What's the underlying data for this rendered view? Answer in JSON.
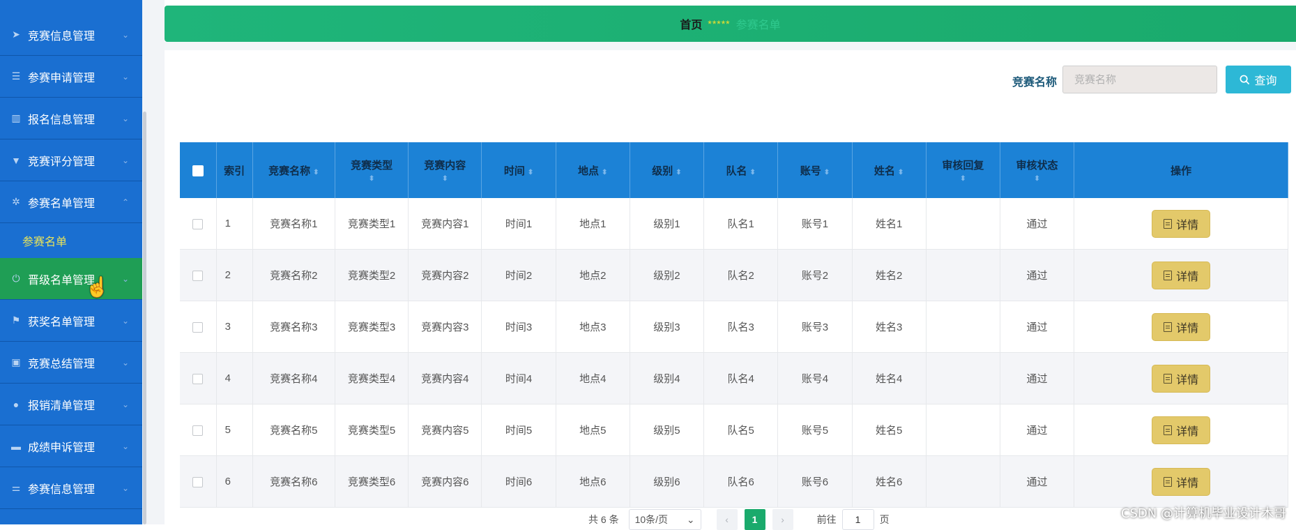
{
  "sidebar": {
    "items": [
      {
        "label": "竞赛信息管理",
        "icon": "send-icon",
        "glyph": "➤",
        "chevron": "⌄"
      },
      {
        "label": "参赛申请管理",
        "icon": "list-icon",
        "glyph": "☰",
        "chevron": "⌄"
      },
      {
        "label": "报名信息管理",
        "icon": "chart-icon",
        "glyph": "▥",
        "chevron": "⌄"
      },
      {
        "label": "竞赛评分管理",
        "icon": "comment-icon",
        "glyph": "▼",
        "chevron": "⌄"
      },
      {
        "label": "参赛名单管理",
        "icon": "settings-icon",
        "glyph": "✲",
        "chevron": "⌃"
      },
      {
        "label": "晋级名单管理",
        "icon": "power-icon",
        "glyph": "⏻",
        "chevron": "⌄"
      },
      {
        "label": "获奖名单管理",
        "icon": "flag-icon",
        "glyph": "⚑",
        "chevron": "⌄"
      },
      {
        "label": "竞赛总结管理",
        "icon": "clipboard-icon",
        "glyph": "▣",
        "chevron": "⌄"
      },
      {
        "label": "报销清单管理",
        "icon": "location-icon",
        "glyph": "●",
        "chevron": "⌄"
      },
      {
        "label": "成绩申诉管理",
        "icon": "monitor-icon",
        "glyph": "▬",
        "chevron": "⌄"
      },
      {
        "label": "参赛信息管理",
        "icon": "sliders-icon",
        "glyph": "⚌",
        "chevron": "⌄"
      }
    ],
    "submenu": {
      "label": "参赛名单"
    }
  },
  "header": {
    "home": "首页",
    "separator": "*****",
    "current": "参赛名单"
  },
  "search": {
    "label": "竞赛名称",
    "placeholder": "竞赛名称",
    "button_label": "查询",
    "button_icon": "search-icon"
  },
  "table": {
    "columns": [
      "索引",
      "竞赛名称",
      "竞赛类型",
      "竞赛内容",
      "时间",
      "地点",
      "级别",
      "队名",
      "账号",
      "姓名",
      "审核回复",
      "审核状态",
      "操作"
    ],
    "rows": [
      {
        "index": "1",
        "name": "竞赛名称1",
        "type": "竞赛类型1",
        "content": "竞赛内容1",
        "time": "时间1",
        "place": "地点1",
        "level": "级别1",
        "team": "队名1",
        "account": "账号1",
        "person": "姓名1",
        "reply": "",
        "status": "通过",
        "action": "详情"
      },
      {
        "index": "2",
        "name": "竞赛名称2",
        "type": "竞赛类型2",
        "content": "竞赛内容2",
        "time": "时间2",
        "place": "地点2",
        "level": "级别2",
        "team": "队名2",
        "account": "账号2",
        "person": "姓名2",
        "reply": "",
        "status": "通过",
        "action": "详情"
      },
      {
        "index": "3",
        "name": "竞赛名称3",
        "type": "竞赛类型3",
        "content": "竞赛内容3",
        "time": "时间3",
        "place": "地点3",
        "level": "级别3",
        "team": "队名3",
        "account": "账号3",
        "person": "姓名3",
        "reply": "",
        "status": "通过",
        "action": "详情"
      },
      {
        "index": "4",
        "name": "竞赛名称4",
        "type": "竞赛类型4",
        "content": "竞赛内容4",
        "time": "时间4",
        "place": "地点4",
        "level": "级别4",
        "team": "队名4",
        "account": "账号4",
        "person": "姓名4",
        "reply": "",
        "status": "通过",
        "action": "详情"
      },
      {
        "index": "5",
        "name": "竞赛名称5",
        "type": "竞赛类型5",
        "content": "竞赛内容5",
        "time": "时间5",
        "place": "地点5",
        "level": "级别5",
        "team": "队名5",
        "account": "账号5",
        "person": "姓名5",
        "reply": "",
        "status": "通过",
        "action": "详情"
      },
      {
        "index": "6",
        "name": "竞赛名称6",
        "type": "竞赛类型6",
        "content": "竞赛内容6",
        "time": "时间6",
        "place": "地点6",
        "level": "级别6",
        "team": "队名6",
        "account": "账号6",
        "person": "姓名6",
        "reply": "",
        "status": "通过",
        "action": "详情"
      }
    ]
  },
  "pagination": {
    "total": "共 6 条",
    "page_size": "10条/页",
    "current_page": "1",
    "goto_label": "前往",
    "goto_value": "1",
    "goto_unit": "页"
  },
  "watermark": "CSDN @计算机毕业设计木哥",
  "colors": {
    "sidebar": "#1a6fd1",
    "sidebar_active": "#1f9e55",
    "header": "#1fb57a",
    "table_header": "#1c82d6",
    "search_button": "#2db8d6",
    "detail_button": "#e3c96a",
    "page_active": "#1aaa6c"
  }
}
